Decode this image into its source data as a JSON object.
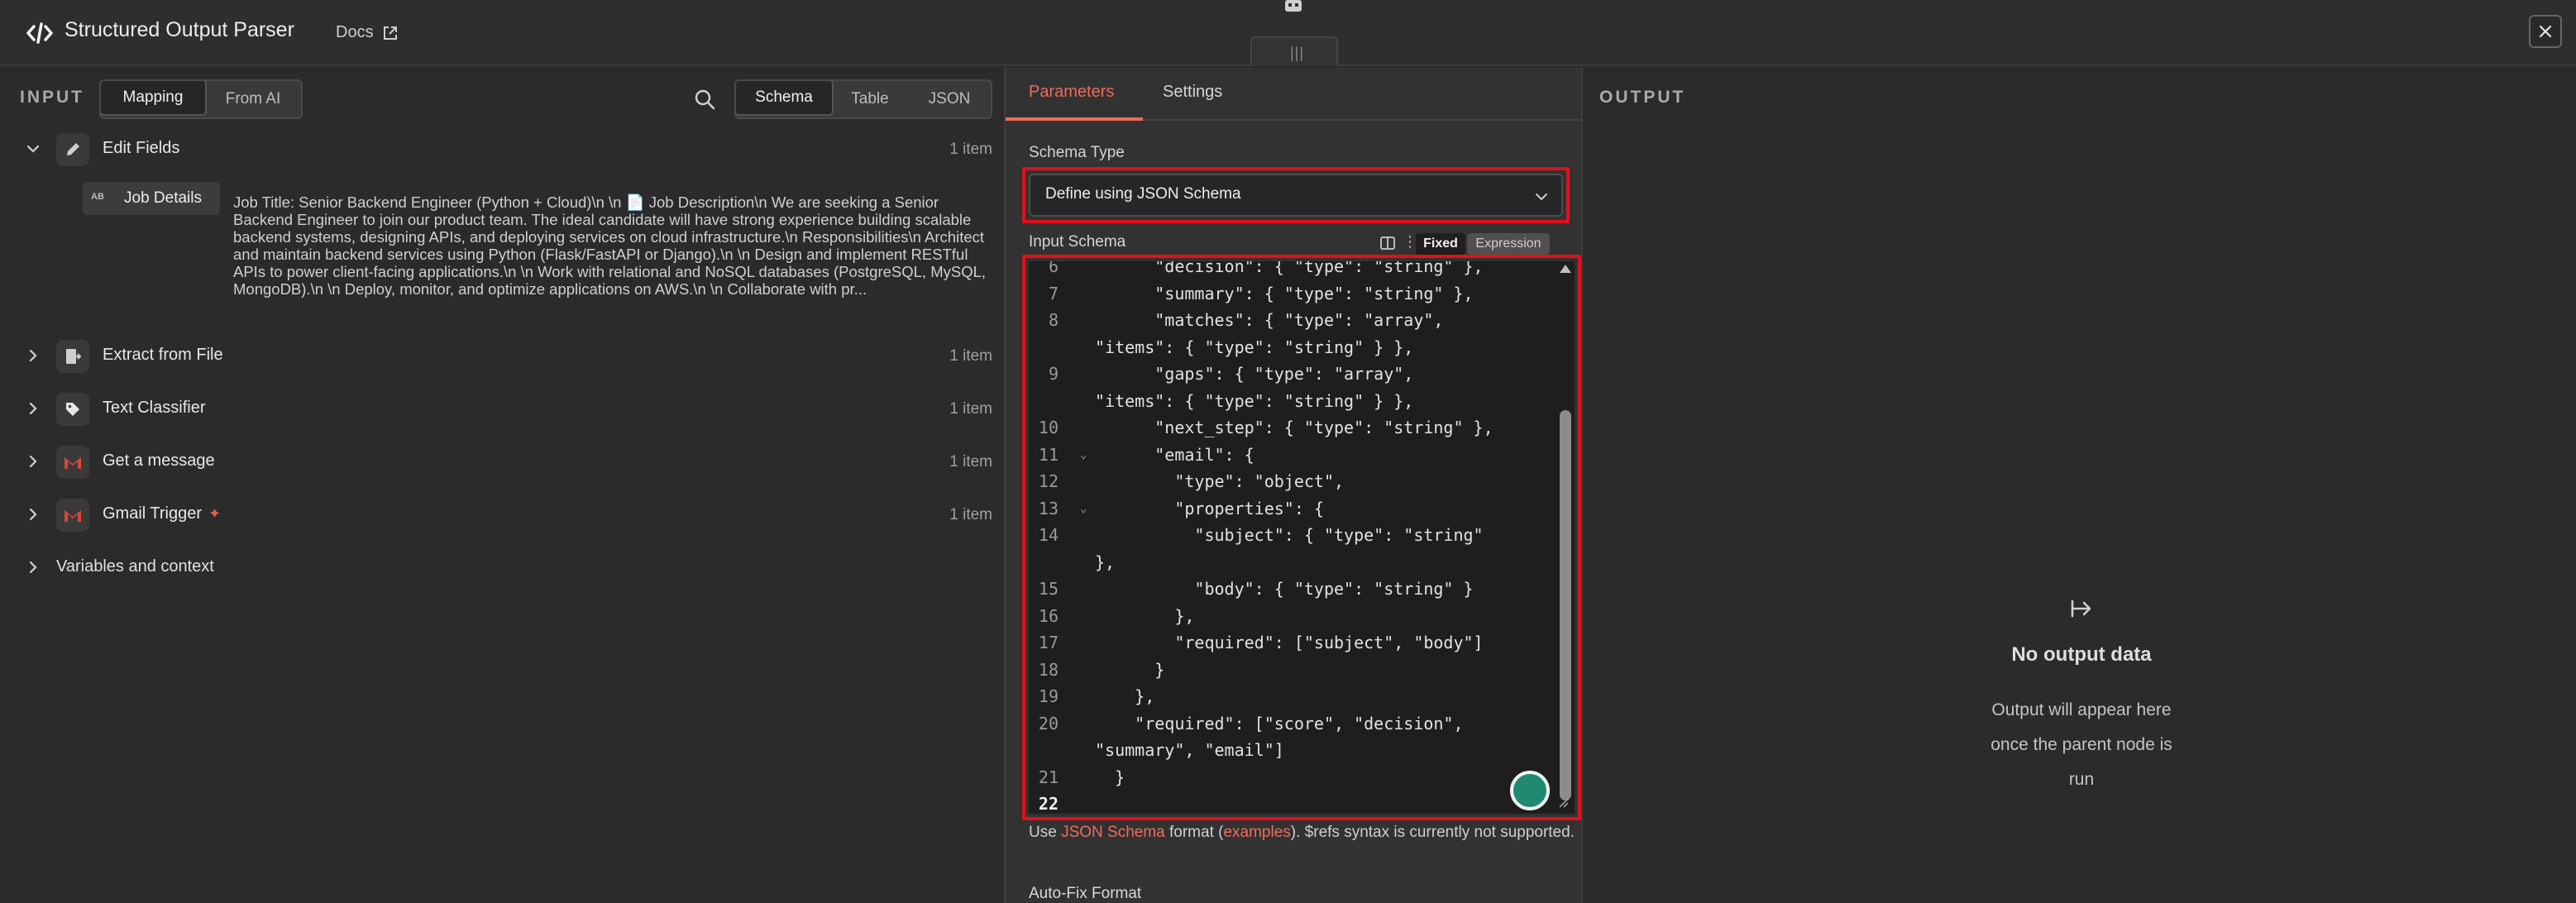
{
  "header": {
    "title": "Structured Output Parser",
    "docs_label": "Docs"
  },
  "input": {
    "section_label": "INPUT",
    "mode_tabs": [
      "Mapping",
      "From AI"
    ],
    "view_tabs": [
      "Schema",
      "Table",
      "JSON"
    ],
    "nodes": [
      {
        "name": "Edit Fields",
        "count": "1 item",
        "icon": "pencil-icon",
        "expanded": true
      },
      {
        "name": "Extract from File",
        "count": "1 item",
        "icon": "file-extract-icon"
      },
      {
        "name": "Text Classifier",
        "count": "1 item",
        "icon": "tag-icon"
      },
      {
        "name": "Get a message",
        "count": "1 item",
        "icon": "gmail-icon"
      },
      {
        "name": "Gmail Trigger",
        "count": "1 item",
        "icon": "gmail-icon",
        "trigger": true
      }
    ],
    "field": {
      "type_badge": "AB",
      "name": "Job Details",
      "value": "Job Title: Senior Backend Engineer (Python + Cloud)\\n \\n 📄 Job Description\\n We are seeking a Senior Backend Engineer to join our product team. The ideal candidate will have strong experience building scalable backend systems, designing APIs, and deploying services on cloud infrastructure.\\n Responsibilities\\n Architect and maintain backend services using Python (Flask/FastAPI or Django).\\n \\n Design and implement RESTful APIs to power client-facing applications.\\n \\n Work with relational and NoSQL databases (PostgreSQL, MySQL, MongoDB).\\n \\n Deploy, monitor, and optimize applications on AWS.\\n \\n Collaborate with pr..."
    },
    "variables_label": "Variables and context"
  },
  "params": {
    "tabs": [
      "Parameters",
      "Settings"
    ],
    "schema_type_label": "Schema Type",
    "schema_type_value": "Define using JSON Schema",
    "input_schema_label": "Input Schema",
    "mode_fixed": "Fixed",
    "mode_expression": "Expression",
    "code_lines": [
      {
        "ln": "6",
        "fold": "",
        "text": "      \"decision\": { \"type\": \"string\" },"
      },
      {
        "ln": "7",
        "fold": "",
        "text": "      \"summary\": { \"type\": \"string\" },"
      },
      {
        "ln": "8",
        "fold": "",
        "text": "      \"matches\": { \"type\": \"array\","
      },
      {
        "ln": "",
        "fold": "",
        "text": "\"items\": { \"type\": \"string\" } },"
      },
      {
        "ln": "9",
        "fold": "",
        "text": "      \"gaps\": { \"type\": \"array\","
      },
      {
        "ln": "",
        "fold": "",
        "text": "\"items\": { \"type\": \"string\" } },"
      },
      {
        "ln": "10",
        "fold": "",
        "text": "      \"next_step\": { \"type\": \"string\" },"
      },
      {
        "ln": "11",
        "fold": "⌄",
        "text": "      \"email\": {"
      },
      {
        "ln": "12",
        "fold": "",
        "text": "        \"type\": \"object\","
      },
      {
        "ln": "13",
        "fold": "⌄",
        "text": "        \"properties\": {"
      },
      {
        "ln": "14",
        "fold": "",
        "text": "          \"subject\": { \"type\": \"string\""
      },
      {
        "ln": "",
        "fold": "",
        "text": "},"
      },
      {
        "ln": "15",
        "fold": "",
        "text": "          \"body\": { \"type\": \"string\" }"
      },
      {
        "ln": "16",
        "fold": "",
        "text": "        },"
      },
      {
        "ln": "17",
        "fold": "",
        "text": "        \"required\": [\"subject\", \"body\"]"
      },
      {
        "ln": "18",
        "fold": "",
        "text": "      }"
      },
      {
        "ln": "19",
        "fold": "",
        "text": "    },"
      },
      {
        "ln": "20",
        "fold": "",
        "text": "    \"required\": [\"score\", \"decision\","
      },
      {
        "ln": "",
        "fold": "",
        "text": "\"summary\", \"email\"]"
      },
      {
        "ln": "21",
        "fold": "",
        "text": "  }"
      },
      {
        "ln": "22",
        "fold": "",
        "text": ""
      }
    ],
    "help_prefix": "Use ",
    "help_link": "JSON Schema",
    "help_mid": " format (",
    "help_link2": "examples",
    "help_suffix": "). $refs syntax is currently not supported.",
    "autofix_label": "Auto-Fix Format"
  },
  "output": {
    "section_label": "OUTPUT",
    "empty_title": "No output data",
    "empty_line1": "Output will appear here",
    "empty_line2": "once the parent node is",
    "empty_line3": "run"
  },
  "colors": {
    "accent": "#f06b5c",
    "highlight_border": "#e0101c",
    "gmail_red": "#d9473b"
  }
}
